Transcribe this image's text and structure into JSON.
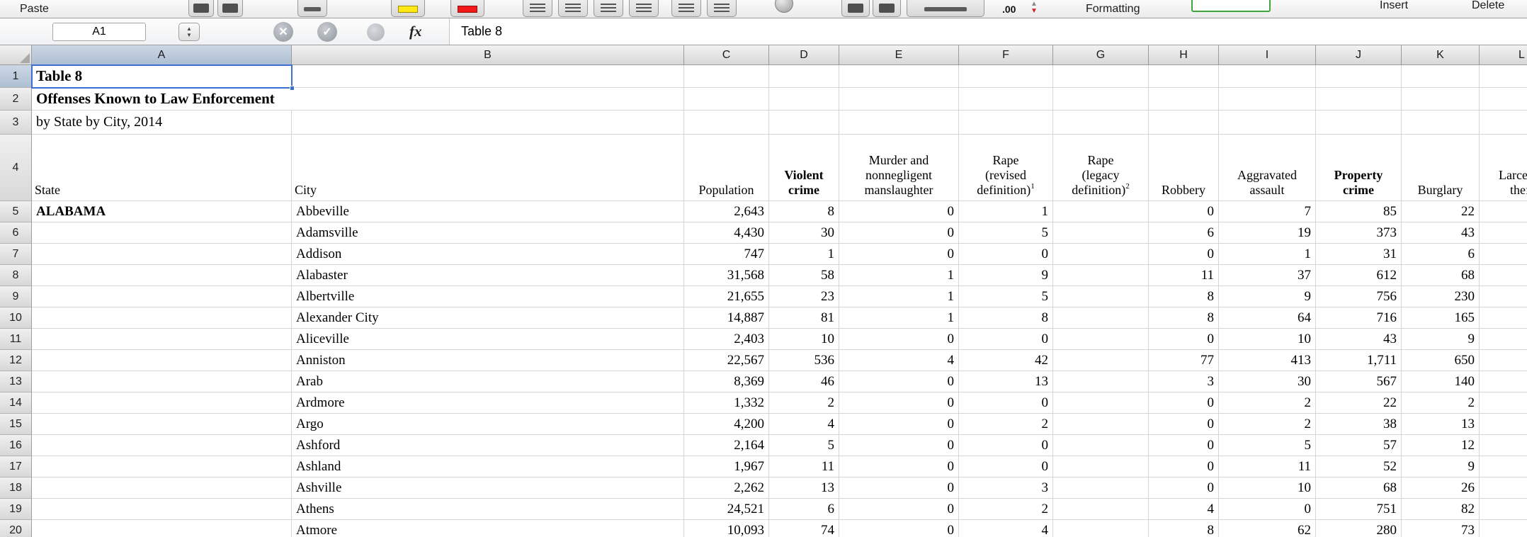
{
  "toolbar": {
    "paste": "Paste",
    "formatting": "Formatting",
    "insert": "Insert",
    "delete": "Delete",
    "decimal": ".00"
  },
  "formula_bar": {
    "cell_ref": "A1",
    "cancel_glyph": "✕",
    "accept_glyph": "✓",
    "fx": "fx",
    "value": "Table 8"
  },
  "grid": {
    "selected_cell": "A1",
    "selected_column": "A",
    "selected_row": 1,
    "columns": [
      "A",
      "B",
      "C",
      "D",
      "E",
      "F",
      "G",
      "H",
      "I",
      "J",
      "K",
      "L"
    ],
    "titles": [
      {
        "row": 1,
        "text": "Table 8",
        "bold": true
      },
      {
        "row": 2,
        "text": "Offenses Known to Law Enforcement",
        "bold": true,
        "merged": true
      },
      {
        "row": 3,
        "text": "by State by City, 2014",
        "bold": false
      }
    ],
    "header_row": 4,
    "column_headers": [
      {
        "col": "A",
        "lines": [
          "State"
        ],
        "align": "left"
      },
      {
        "col": "B",
        "lines": [
          "City"
        ],
        "align": "left"
      },
      {
        "col": "C",
        "lines": [
          "Population"
        ],
        "align": "center"
      },
      {
        "col": "D",
        "lines": [
          "Violent",
          "crime"
        ],
        "align": "center",
        "bold": true
      },
      {
        "col": "E",
        "lines": [
          "Murder and",
          "nonnegligent",
          "manslaughter"
        ],
        "align": "center"
      },
      {
        "col": "F",
        "lines": [
          "Rape",
          "(revised",
          "definition)"
        ],
        "sup": "1",
        "align": "center"
      },
      {
        "col": "G",
        "lines": [
          "Rape",
          "(legacy",
          "definition)"
        ],
        "sup": "2",
        "align": "center"
      },
      {
        "col": "H",
        "lines": [
          "Robbery"
        ],
        "align": "center"
      },
      {
        "col": "I",
        "lines": [
          "Aggravated",
          "assault"
        ],
        "align": "center"
      },
      {
        "col": "J",
        "lines": [
          "Property",
          "crime"
        ],
        "align": "center",
        "bold": true
      },
      {
        "col": "K",
        "lines": [
          "Burglary"
        ],
        "align": "center"
      },
      {
        "col": "L",
        "lines": [
          "Larceny-",
          "theft"
        ],
        "align": "center"
      }
    ],
    "state_label": "ALABAMA",
    "data_rows": [
      {
        "row": 5,
        "state": "ALABAMA",
        "city": "Abbeville",
        "values": [
          "2,643",
          "8",
          "0",
          "1",
          "",
          "0",
          "7",
          "85",
          "22"
        ]
      },
      {
        "row": 6,
        "city": "Adamsville",
        "values": [
          "4,430",
          "30",
          "0",
          "5",
          "",
          "6",
          "19",
          "373",
          "43"
        ]
      },
      {
        "row": 7,
        "city": "Addison",
        "values": [
          "747",
          "1",
          "0",
          "0",
          "",
          "0",
          "1",
          "31",
          "6"
        ]
      },
      {
        "row": 8,
        "city": "Alabaster",
        "values": [
          "31,568",
          "58",
          "1",
          "9",
          "",
          "11",
          "37",
          "612",
          "68"
        ]
      },
      {
        "row": 9,
        "city": "Albertville",
        "values": [
          "21,655",
          "23",
          "1",
          "5",
          "",
          "8",
          "9",
          "756",
          "230"
        ]
      },
      {
        "row": 10,
        "city": "Alexander City",
        "values": [
          "14,887",
          "81",
          "1",
          "8",
          "",
          "8",
          "64",
          "716",
          "165"
        ]
      },
      {
        "row": 11,
        "city": "Aliceville",
        "values": [
          "2,403",
          "10",
          "0",
          "0",
          "",
          "0",
          "10",
          "43",
          "9"
        ]
      },
      {
        "row": 12,
        "city": "Anniston",
        "values": [
          "22,567",
          "536",
          "4",
          "42",
          "",
          "77",
          "413",
          "1,711",
          "650"
        ]
      },
      {
        "row": 13,
        "city": "Arab",
        "values": [
          "8,369",
          "46",
          "0",
          "13",
          "",
          "3",
          "30",
          "567",
          "140"
        ]
      },
      {
        "row": 14,
        "city": "Ardmore",
        "values": [
          "1,332",
          "2",
          "0",
          "0",
          "",
          "0",
          "2",
          "22",
          "2"
        ]
      },
      {
        "row": 15,
        "city": "Argo",
        "values": [
          "4,200",
          "4",
          "0",
          "2",
          "",
          "0",
          "2",
          "38",
          "13"
        ]
      },
      {
        "row": 16,
        "city": "Ashford",
        "values": [
          "2,164",
          "5",
          "0",
          "0",
          "",
          "0",
          "5",
          "57",
          "12"
        ]
      },
      {
        "row": 17,
        "city": "Ashland",
        "values": [
          "1,967",
          "11",
          "0",
          "0",
          "",
          "0",
          "11",
          "52",
          "9"
        ]
      },
      {
        "row": 18,
        "city": "Ashville",
        "values": [
          "2,262",
          "13",
          "0",
          "3",
          "",
          "0",
          "10",
          "68",
          "26"
        ]
      },
      {
        "row": 19,
        "city": "Athens",
        "values": [
          "24,521",
          "6",
          "0",
          "2",
          "",
          "4",
          "0",
          "751",
          "82"
        ]
      },
      {
        "row": 20,
        "city": "Atmore",
        "values": [
          "10,093",
          "74",
          "0",
          "4",
          "",
          "8",
          "62",
          "280",
          "73"
        ]
      }
    ]
  }
}
